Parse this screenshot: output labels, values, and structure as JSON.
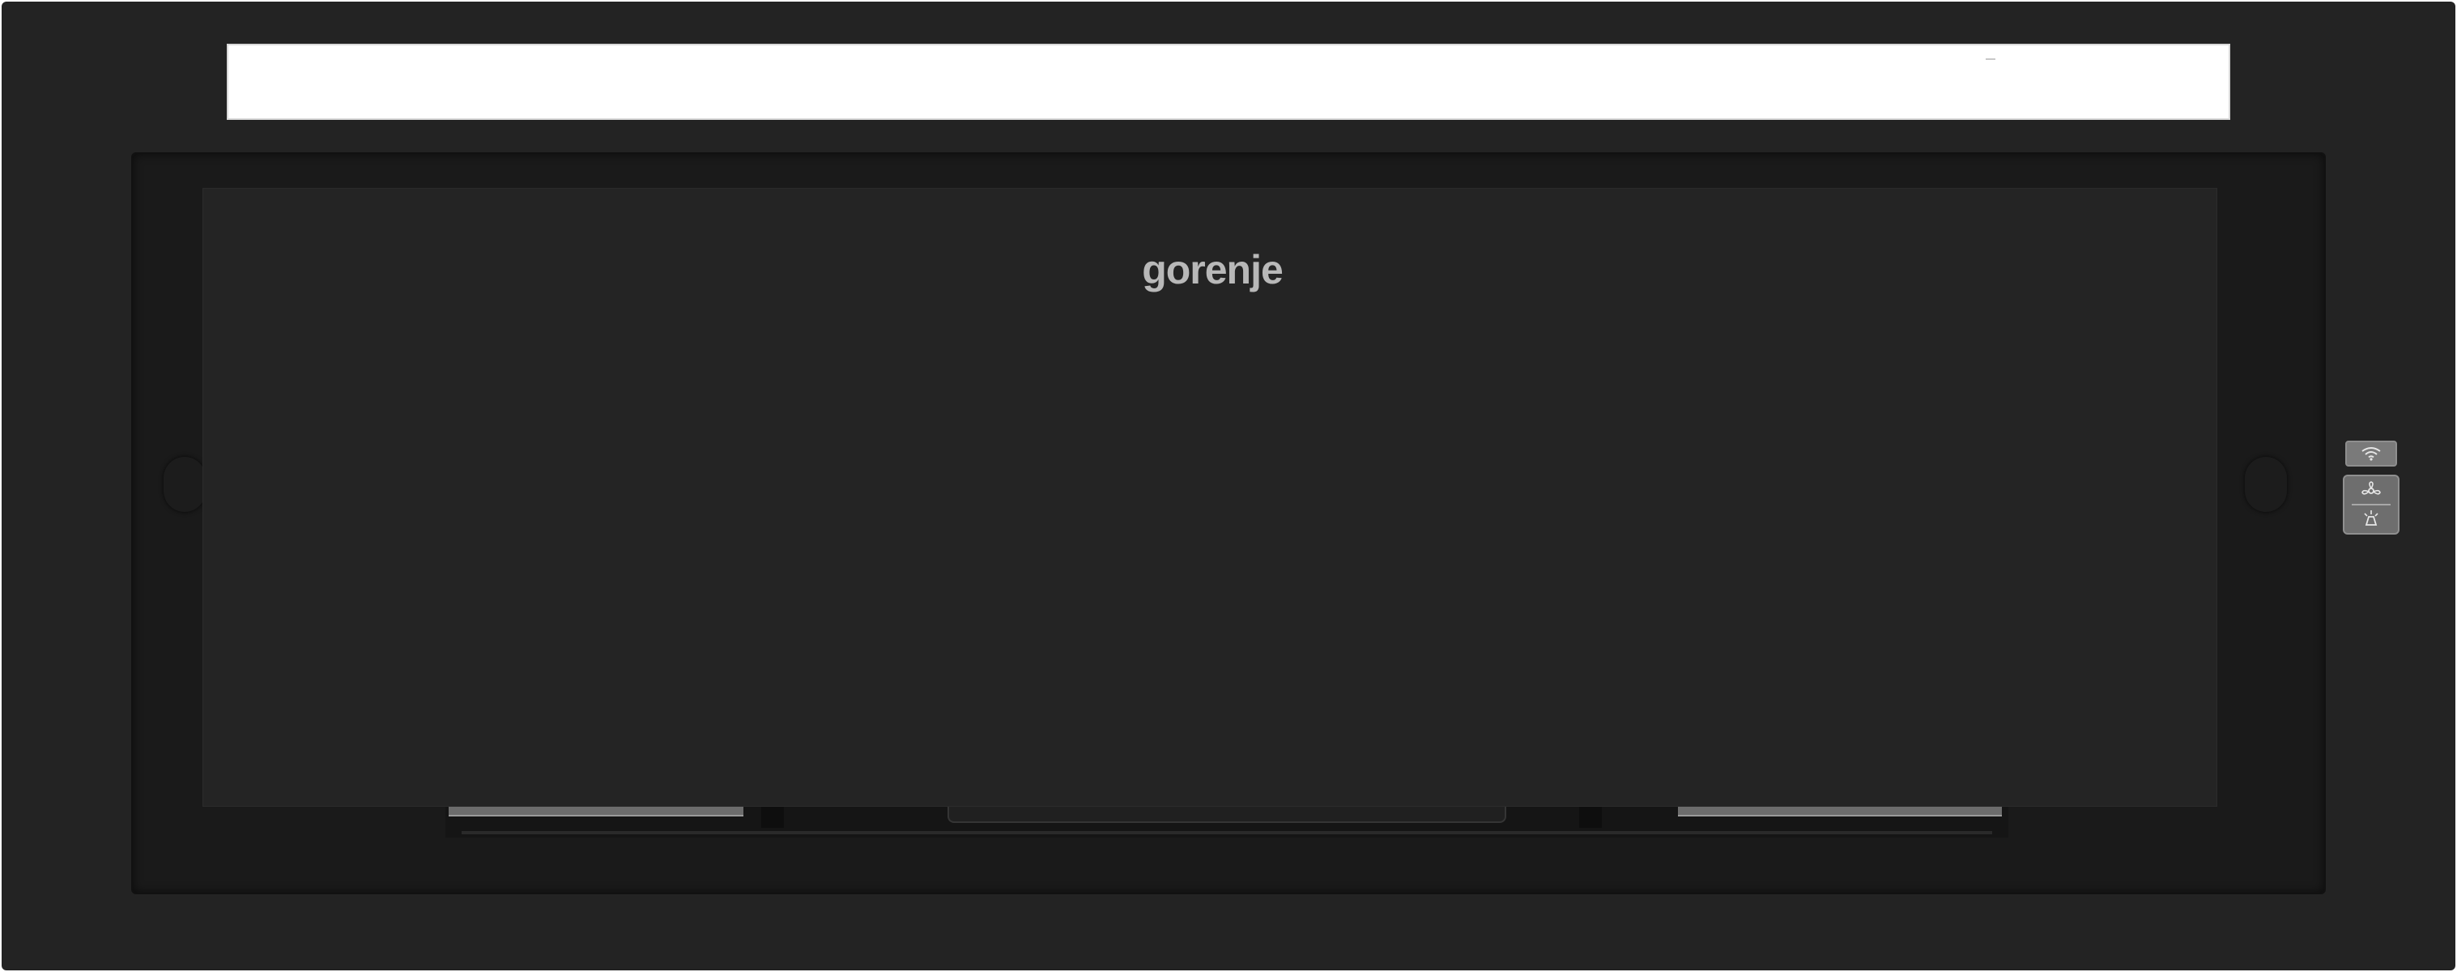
{
  "product": {
    "brand_logo": "gorenje"
  },
  "controls": {
    "wifi_icon": "wifi-icon",
    "fan_icon": "fan-icon",
    "light_icon": "light-icon"
  },
  "colors": {
    "body": "#232323",
    "panel": "#242424",
    "light_strip": "#ffffff",
    "control_pad": "#6e6e6e"
  }
}
